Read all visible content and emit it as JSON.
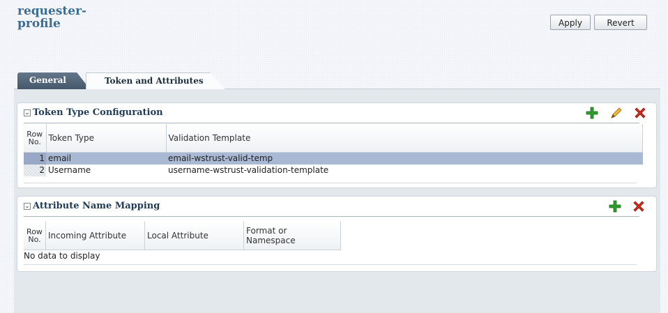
{
  "page": {
    "title": "requester-\nprofile"
  },
  "toolbar": {
    "apply_label": "Apply",
    "revert_label": "Revert"
  },
  "tabs": [
    {
      "label": "General",
      "active": false
    },
    {
      "label": "Token and Attributes",
      "active": true
    }
  ],
  "token_section": {
    "title": "Token Type Configuration",
    "columns": [
      "Row No.",
      "Token Type",
      "Validation Template"
    ],
    "rows": [
      {
        "row": "1",
        "token_type": "email",
        "template": "email-wstrust-valid-temp",
        "selected": true
      },
      {
        "row": "2",
        "token_type": "Username",
        "template": "username-wstrust-validation-template",
        "selected": false
      }
    ]
  },
  "attr_section": {
    "title": "Attribute Name Mapping",
    "columns": [
      "Row No.",
      "Incoming Attribute",
      "Local Attribute",
      "Format or Namespace"
    ],
    "empty_text": "No data to display"
  },
  "colors": {
    "accent": "#3b6d96",
    "add": "#2e9b2e",
    "edit": "#e0a21e",
    "delete": "#d42a1a",
    "selected_row": "#a9b8d3"
  },
  "icons": [
    "add-icon",
    "edit-icon",
    "delete-icon",
    "collapse-icon"
  ]
}
